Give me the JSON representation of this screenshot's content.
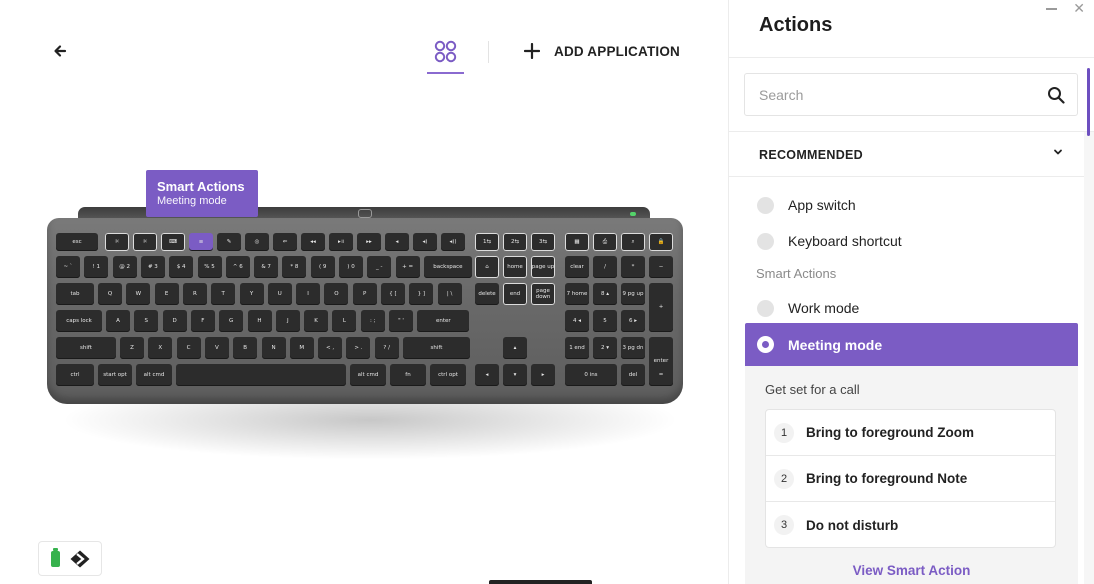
{
  "canvas": {
    "add_application_label": "ADD APPLICATION",
    "callout": {
      "title": "Smart Actions",
      "subtitle": "Meeting mode"
    }
  },
  "panel": {
    "title": "Actions",
    "search": {
      "placeholder": "Search",
      "value": ""
    },
    "section": {
      "label": "RECOMMENDED"
    },
    "items": [
      {
        "label": "App switch"
      },
      {
        "label": "Keyboard shortcut"
      }
    ],
    "smart_actions_heading": "Smart Actions",
    "smart_items": [
      {
        "label": "Work mode"
      },
      {
        "label": "Meeting mode",
        "selected": true
      }
    ],
    "detail": {
      "description": "Get set for a call",
      "steps": [
        {
          "num": "1",
          "label": "Bring to foreground Zoom"
        },
        {
          "num": "2",
          "label": "Bring to foreground Note"
        },
        {
          "num": "3",
          "label": "Do not disturb"
        }
      ],
      "link": "View Smart Action"
    }
  },
  "keyboard": {
    "fn_row": [
      "esc",
      "☼",
      "☼",
      "⌨",
      "≡",
      "✎",
      "◎",
      "⇐",
      "◂◂",
      "▸॥",
      "▸▸",
      "◂",
      "◂)",
      "◂))",
      "1⇆",
      "2⇆",
      "3⇆",
      "▦",
      "⎙",
      "⌕",
      "🔒"
    ],
    "num_row": [
      "~ `",
      "! 1",
      "@ 2",
      "# 3",
      "$ 4",
      "% 5",
      "^ 6",
      "& 7",
      "* 8",
      "( 9",
      ") 0",
      "_ -",
      "+ =",
      "backspace"
    ],
    "nav_row1": [
      "⌂",
      "home",
      "page up"
    ],
    "pad_row1": [
      "clear",
      "/",
      "*",
      "−"
    ],
    "q_row": [
      "tab",
      "Q",
      "W",
      "E",
      "R",
      "T",
      "Y",
      "U",
      "I",
      "O",
      "P",
      "{ [",
      "} ]",
      "| \\"
    ],
    "nav_row2": [
      "delete",
      "end",
      "page down"
    ],
    "pad_row2": [
      "7 home",
      "8 ▴",
      "9 pg up"
    ],
    "a_row": [
      "caps lock",
      "A",
      "S",
      "D",
      "F",
      "G",
      "H",
      "J",
      "K",
      "L",
      ": ;",
      "\" '",
      "enter"
    ],
    "pad_row3": [
      "4 ◂",
      "5",
      "6 ▸"
    ],
    "z_row": [
      "shift",
      "Z",
      "X",
      "C",
      "V",
      "B",
      "N",
      "M",
      "< ,",
      "> .",
      "? /",
      "shift"
    ],
    "pad_row4": [
      "1 end",
      "2 ▾",
      "3 pg dn"
    ],
    "bottom_row": [
      "ctrl",
      "start opt",
      "alt cmd",
      "",
      "alt cmd",
      "fn",
      "ctrl opt"
    ],
    "arrows": [
      "▴",
      "◂",
      "▾",
      "▸"
    ],
    "pad_row5": [
      "0 ins",
      "del"
    ],
    "pad_plus": "+",
    "pad_enter": "enter",
    "pad_equal": "="
  },
  "colors": {
    "accent": "#7b5cc4",
    "battery": "#37b24d"
  }
}
